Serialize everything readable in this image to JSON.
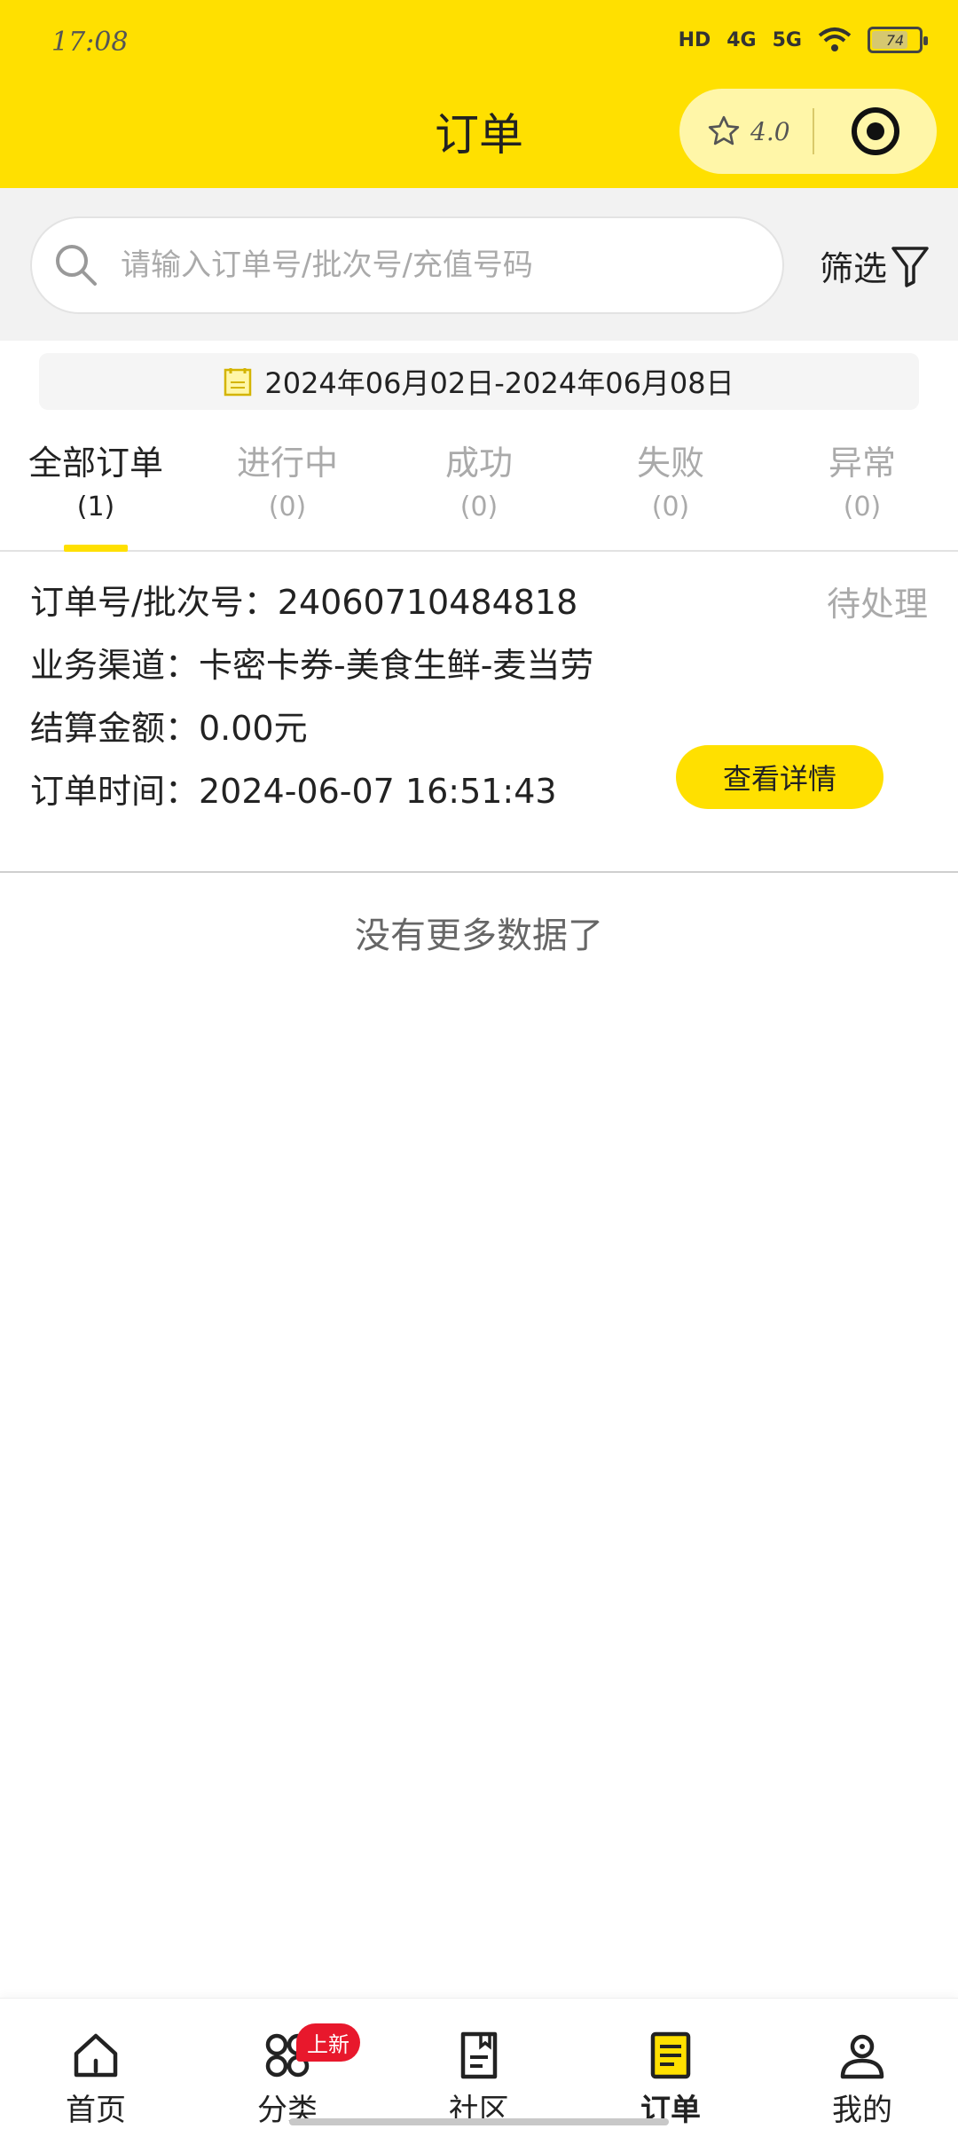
{
  "status_bar": {
    "time": "17:08",
    "network_hd": "HD",
    "network_4g": "4G",
    "network_5g": "5G",
    "battery": "74"
  },
  "header": {
    "title": "订单",
    "rating": "4.0"
  },
  "search": {
    "placeholder": "请输入订单号/批次号/充值号码",
    "filter_label": "筛选"
  },
  "date_range": "2024年06月02日-2024年06月08日",
  "tabs": [
    {
      "label": "全部订单",
      "count": "(1)"
    },
    {
      "label": "进行中",
      "count": "(0)"
    },
    {
      "label": "成功",
      "count": "(0)"
    },
    {
      "label": "失败",
      "count": "(0)"
    },
    {
      "label": "异常",
      "count": "(0)"
    }
  ],
  "order": {
    "number_line": "订单号/批次号：24060710484818",
    "channel_line": "业务渠道：卡密卡券-美食生鲜-麦当劳",
    "amount_line": "结算金额：0.00元",
    "time_line": "订单时间：2024-06-07 16:51:43",
    "status": "待处理",
    "detail_button": "查看详情"
  },
  "no_more_text": "没有更多数据了",
  "bottom_nav": [
    {
      "label": "首页",
      "icon": "home-icon"
    },
    {
      "label": "分类",
      "icon": "category-icon",
      "badge": "上新"
    },
    {
      "label": "社区",
      "icon": "community-icon"
    },
    {
      "label": "订单",
      "icon": "order-icon"
    },
    {
      "label": "我的",
      "icon": "profile-icon"
    }
  ],
  "colors": {
    "accent": "#FFE000",
    "badge": "#e8182c"
  }
}
